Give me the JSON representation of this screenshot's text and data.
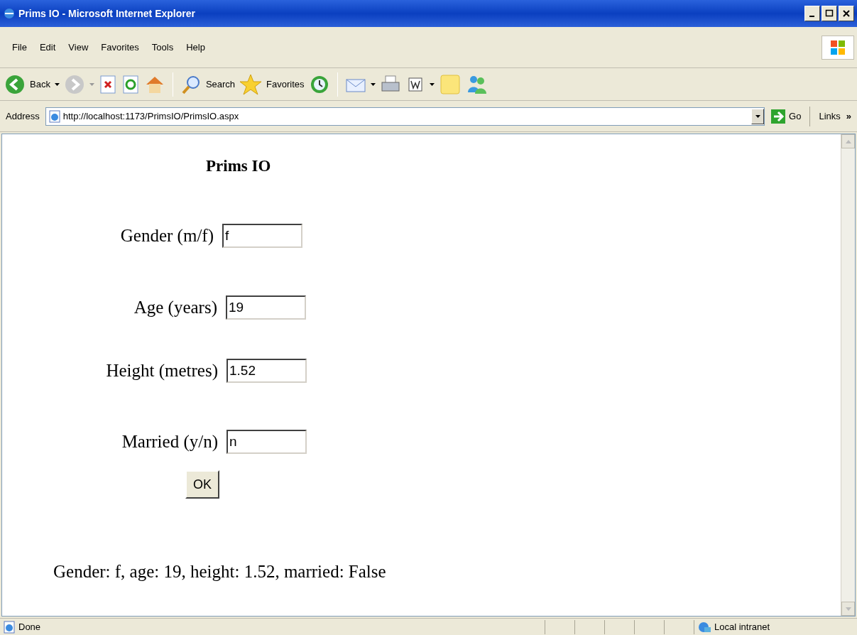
{
  "window": {
    "title": "Prims IO - Microsoft Internet Explorer"
  },
  "menu": [
    {
      "label": "File"
    },
    {
      "label": "Edit"
    },
    {
      "label": "View"
    },
    {
      "label": "Favorites"
    },
    {
      "label": "Tools"
    },
    {
      "label": "Help"
    }
  ],
  "toolbar": {
    "back": "Back",
    "search": "Search",
    "favorites": "Favorites"
  },
  "address_bar": {
    "label": "Address",
    "value": "http://localhost:1173/PrimsIO/PrimsIO.aspx",
    "go": "Go",
    "links": "Links",
    "links_chevron": "»"
  },
  "page": {
    "heading": "Prims IO",
    "fields": [
      {
        "label": "Gender (m/f)",
        "value": "f"
      },
      {
        "label": "Age (years)",
        "value": "19"
      },
      {
        "label": "Height (metres)",
        "value": "1.52"
      },
      {
        "label": "Married (y/n)",
        "value": "n"
      }
    ],
    "button": "OK",
    "result": "Gender: f, age: 19, height: 1.52, married: False"
  },
  "status_bar": {
    "text": "Done",
    "zone": "Local intranet"
  }
}
